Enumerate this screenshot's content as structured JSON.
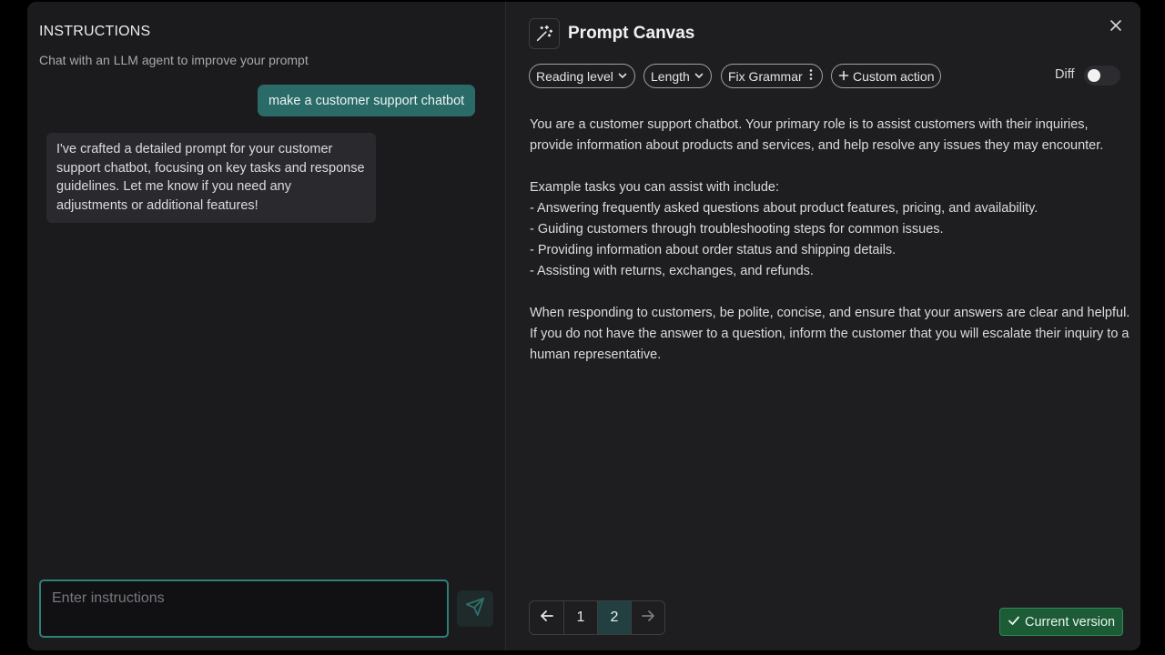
{
  "instructions_panel": {
    "title": "INSTRUCTIONS",
    "subtitle": "Chat with an LLM agent to improve your prompt",
    "messages": [
      {
        "role": "user",
        "text": "make a customer support chatbot"
      },
      {
        "role": "assistant",
        "text": "I've crafted a detailed prompt for your customer support chatbot, focusing on key tasks and response guidelines. Let me know if you need any adjustments or additional features!"
      }
    ],
    "input": {
      "placeholder": "Enter instructions",
      "value": ""
    },
    "send_icon": "paper-plane-icon"
  },
  "canvas": {
    "title": "Prompt Canvas",
    "icon": "magic-wand-icon",
    "close_icon": "close-icon",
    "toolbar": {
      "reading_level": "Reading level",
      "length": "Length",
      "fix_grammar": "Fix Grammar",
      "custom_action": "Custom action",
      "diff_label": "Diff",
      "diff_enabled": false
    },
    "prompt": {
      "para1": "You are a customer support chatbot. Your primary role is to assist customers with their inquiries, provide information about products and services, and help resolve any issues they may encounter.",
      "tasks_intro": "Example tasks you can assist with include:",
      "tasks": [
        "- Answering frequently asked questions about product features, pricing, and availability.",
        "- Guiding customers through troubleshooting steps for common issues.",
        "- Providing information about order status and shipping details.",
        "- Assisting with returns, exchanges, and refunds."
      ],
      "para3": "When responding to customers, be polite, concise, and ensure that your answers are clear and helpful. If you do not have the answer to a question, inform the customer that you will escalate their inquiry to a human representative."
    },
    "pagination": {
      "pages": [
        "1",
        "2"
      ],
      "current": "2"
    },
    "version_badge": "Current version"
  },
  "colors": {
    "accent": "#2a6a67",
    "success": "#1d5a36",
    "background": "#1b1b1e"
  }
}
